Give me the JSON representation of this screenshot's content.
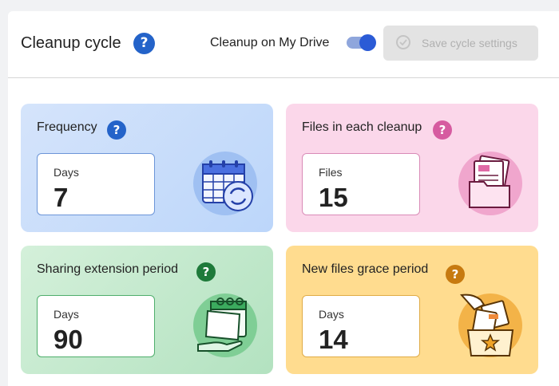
{
  "header": {
    "title": "Cleanup cycle",
    "help_glyph": "?",
    "toggle_label": "Cleanup on My Drive",
    "toggle_on": true,
    "save_label": "Save cycle settings"
  },
  "cards": {
    "frequency": {
      "title": "Frequency",
      "unit": "Days",
      "value": "7",
      "help_color": "#2463c9",
      "help_glyph": "?"
    },
    "files": {
      "title": "Files in each cleanup",
      "unit": "Files",
      "value": "15",
      "help_color": "#d65ba0",
      "help_glyph": "?"
    },
    "sharing": {
      "title": "Sharing extension period",
      "unit": "Days",
      "value": "90",
      "help_color": "#1e7a3a",
      "help_glyph": "?"
    },
    "grace": {
      "title": "New files grace period",
      "unit": "Days",
      "value": "14",
      "help_color": "#c77a10",
      "help_glyph": "?"
    }
  },
  "icons": {
    "frequency": "calendar-refresh-icon",
    "files": "folder-documents-icon",
    "sharing": "calendar-hand-icon",
    "grace": "hand-box-star-icon"
  }
}
